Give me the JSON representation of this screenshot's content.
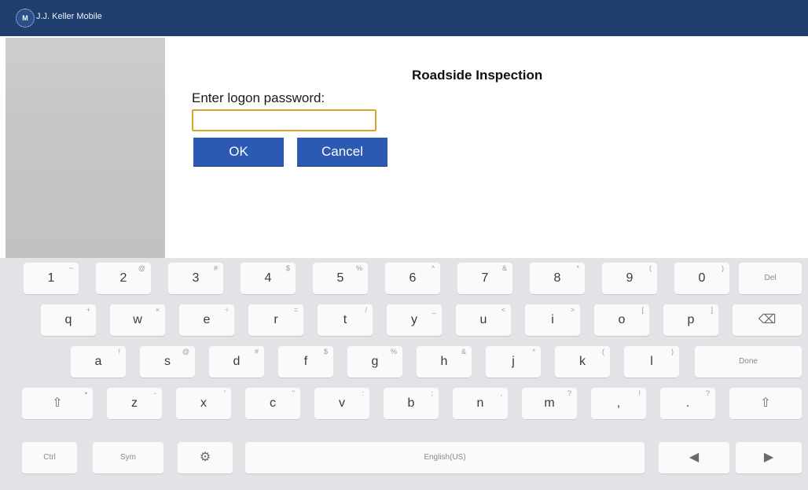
{
  "app": {
    "title": "J.J. Keller Mobile",
    "logo_text": "M"
  },
  "dialog": {
    "title": "Roadside Inspection",
    "prompt": "Enter logon password:",
    "password_value": "",
    "ok_label": "OK",
    "cancel_label": "Cancel"
  },
  "keyboard": {
    "row1": [
      {
        "label": "1",
        "sub": "~"
      },
      {
        "label": "2",
        "sub": "@"
      },
      {
        "label": "3",
        "sub": "#"
      },
      {
        "label": "4",
        "sub": "$"
      },
      {
        "label": "5",
        "sub": "%"
      },
      {
        "label": "6",
        "sub": "^"
      },
      {
        "label": "7",
        "sub": "&"
      },
      {
        "label": "8",
        "sub": "*"
      },
      {
        "label": "9",
        "sub": "("
      },
      {
        "label": "0",
        "sub": ")"
      },
      {
        "label": "Del",
        "sub": ""
      }
    ],
    "row2": [
      {
        "label": "q",
        "sub": "+"
      },
      {
        "label": "w",
        "sub": "×"
      },
      {
        "label": "e",
        "sub": "÷"
      },
      {
        "label": "r",
        "sub": "="
      },
      {
        "label": "t",
        "sub": "/"
      },
      {
        "label": "y",
        "sub": "_"
      },
      {
        "label": "u",
        "sub": "<"
      },
      {
        "label": "i",
        "sub": ">"
      },
      {
        "label": "o",
        "sub": "["
      },
      {
        "label": "p",
        "sub": "]"
      },
      {
        "label": "⌫",
        "sub": ""
      }
    ],
    "row3": [
      {
        "label": "a",
        "sub": "!"
      },
      {
        "label": "s",
        "sub": "@"
      },
      {
        "label": "d",
        "sub": "#"
      },
      {
        "label": "f",
        "sub": "$"
      },
      {
        "label": "g",
        "sub": "%"
      },
      {
        "label": "h",
        "sub": "&"
      },
      {
        "label": "j",
        "sub": "*"
      },
      {
        "label": "k",
        "sub": "("
      },
      {
        "label": "l",
        "sub": ")"
      },
      {
        "label": "Done",
        "sub": ""
      }
    ],
    "row4": [
      {
        "label": "⇧",
        "sub": "•"
      },
      {
        "label": "z",
        "sub": "-"
      },
      {
        "label": "x",
        "sub": "'"
      },
      {
        "label": "c",
        "sub": "\""
      },
      {
        "label": "v",
        "sub": ":"
      },
      {
        "label": "b",
        "sub": ";"
      },
      {
        "label": "n",
        "sub": ","
      },
      {
        "label": "m",
        "sub": "?"
      },
      {
        "label": ",",
        "sub": "!"
      },
      {
        "label": ".",
        "sub": "?"
      },
      {
        "label": "⇧",
        "sub": ""
      }
    ],
    "row5": [
      {
        "label": "Ctrl",
        "sub": ""
      },
      {
        "label": "Sym",
        "sub": ""
      },
      {
        "label": "⚙",
        "sub": ""
      },
      {
        "label": "English(US)",
        "sub": ""
      },
      {
        "label": "◀",
        "sub": ""
      },
      {
        "label": "▶",
        "sub": ""
      }
    ]
  }
}
